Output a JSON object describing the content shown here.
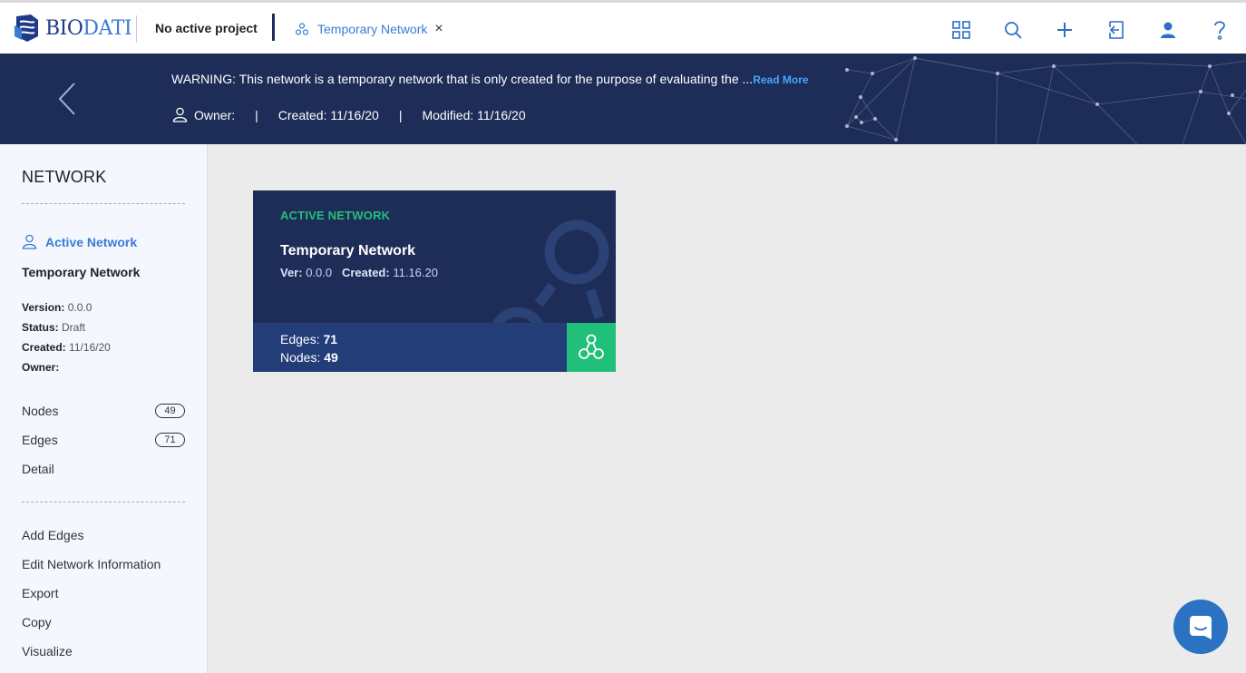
{
  "header": {
    "logo_text_bold": "BIO",
    "logo_text_light": "DATI",
    "project_label": "No active project",
    "tab_label": "Temporary Network",
    "tab_close": "×",
    "icons": [
      "grid-icon",
      "search-icon",
      "plus-icon",
      "import-icon",
      "user-icon",
      "help-icon"
    ]
  },
  "banner": {
    "warning_text": "WARNING: This network is a temporary network that is only created for the purpose of evaluating the ...",
    "read_more": "Read More",
    "owner_label": "Owner:",
    "separator": "|",
    "created": "Created: 11/16/20",
    "modified": "Modified: 11/16/20"
  },
  "sidebar": {
    "title": "NETWORK",
    "active_label": "Active Network",
    "network_name": "Temporary Network",
    "version_label": "Version:",
    "version_value": "0.0.0",
    "status_label": "Status:",
    "status_value": "Draft",
    "created_label": "Created:",
    "created_value": "11/16/20",
    "owner_label": "Owner:",
    "nodes_label": "Nodes",
    "nodes_count": "49",
    "edges_label": "Edges",
    "edges_count": "71",
    "detail_label": "Detail",
    "actions": [
      "Add Edges",
      "Edit Network Information",
      "Export",
      "Copy",
      "Visualize"
    ]
  },
  "card": {
    "label": "ACTIVE NETWORK",
    "title": "Temporary Network",
    "ver_label": "Ver:",
    "ver_value": "0.0.0",
    "created_label": "Created:",
    "created_value": "11.16.20",
    "edges_label": "Edges:",
    "edges_value": "71",
    "nodes_label": "Nodes:",
    "nodes_value": "49"
  },
  "colors": {
    "navy": "#1e2d57",
    "accent_blue": "#3a7bd5",
    "green": "#21c07a",
    "sidebar_bg": "#f4f8fe",
    "content_bg": "#ebebeb"
  }
}
